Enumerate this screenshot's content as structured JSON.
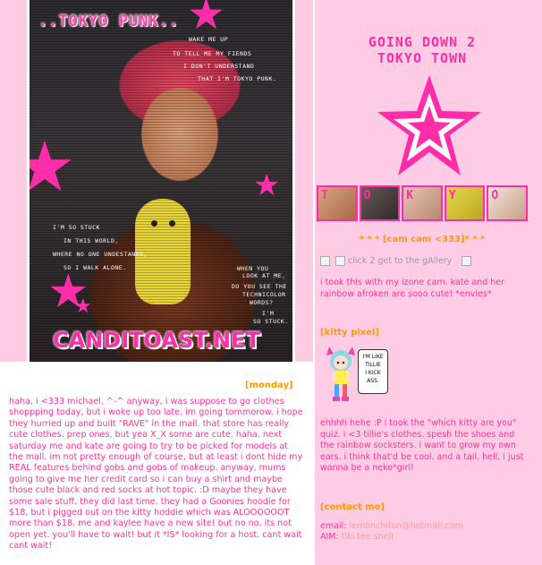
{
  "banner": {
    "title": "..TOKYO PUNK..",
    "site": "CANDITOAST.NET",
    "lyrics_top": [
      "WAKE ME UP",
      "TO TELL ME MY FIENDS",
      "I DON'T UNDERSTAND",
      "THAT I'M TOKYO PUNK."
    ],
    "lyrics_left": [
      "I'M SO STUCK",
      "IN THIS WORLD,",
      "WHERE NO ONE UNDESTANDS,",
      "SO I WALK ALONE."
    ],
    "lyrics_right": [
      "WHEN YOU",
      "LOOK AT ME,",
      "DO YOU SEE THE",
      "TECHNICOLOR",
      "WORDS?",
      "I'M",
      "SO STUCK."
    ]
  },
  "header": {
    "title_line1": "GOING DOWN 2",
    "title_line2": "TOKYO TOWN",
    "tiles": [
      "T",
      "O",
      "K",
      "Y",
      "O"
    ]
  },
  "cam": {
    "heading": "* * * [cam cam <333]* * *",
    "link_text": "click 2 get to the gAllery",
    "caption": "i took this with my izone cam. kate and her rainbow afroken are sooo cute! *envies*"
  },
  "kitty": {
    "heading": "[kitty pixel]",
    "bubble": [
      "I'M LIKE",
      "TILLIE",
      "I KICK",
      "ASS."
    ],
    "text": "ehhhh hehe :P i took the \"which kitty are you\" quiz. i <3 tillie's clothes. spesh the shoes and the rainbow socksters. i want to grow my own ears. i think that'd be cool. and a tail. hell, i just wanna be a neko*girl!"
  },
  "contact": {
    "heading": "[contact me]",
    "email_label": "email:",
    "email_value": "lemonchifon@hotmail.com",
    "aim_label": "AIM:",
    "aim_value": "tiki tee shell"
  },
  "journal": {
    "day": "[monday]",
    "entry": "haha, i <333 michael. ^-^ anyway, i was suppose to go clothes shoppping today, but i woke up too late. im going tommorow. i hope they hurried up and built \"RAVE\" in the mall. that store has really cute clothes. prep ones, but yea X_X some are cute. haha. next saturday me and kate are going to try to be picked for models at the mall. im not pretty enough of course, but at least i dont hide my REAL features behind gobs and gobs of makeup. anyway, mums going to give me her credit card so i can buy a shirt and maybe those cute black and red socks at hot topic. :D maybe they have some sale stuff. they did last time. they had a Goonies hoodie for $18, but i pigged out on the kitty hoddie which was ALOOOOOOT more than $18. me and kaylee have a new site! but no no, its not open yet. you'll have to wait! but it *IS* looking for a host. cant wait cant wait!"
  },
  "colors": {
    "pink_bg": "#ffcce6",
    "hot_pink": "#ff2ea8",
    "text_pink": "#ff3399",
    "heading_orange": "#ff9900"
  }
}
